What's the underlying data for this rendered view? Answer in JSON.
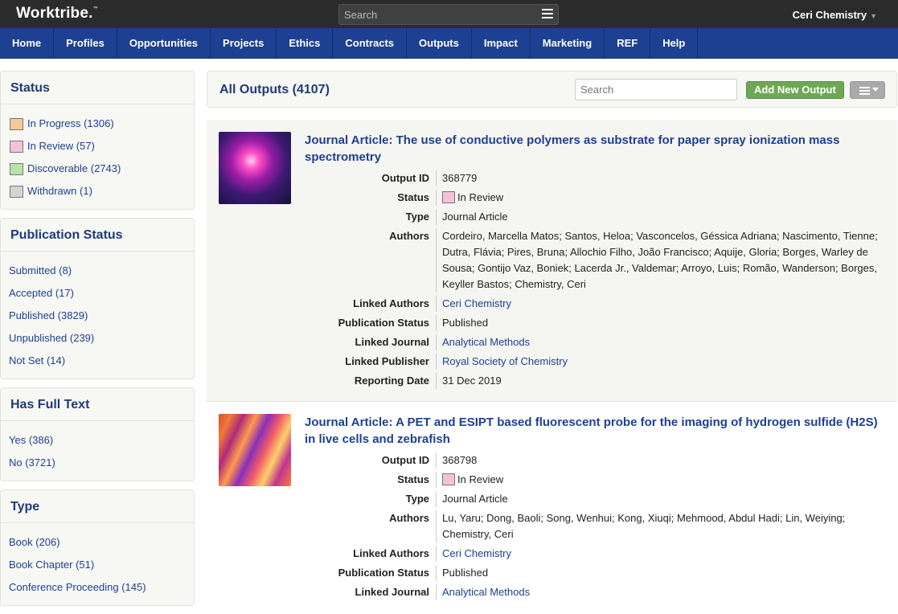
{
  "topbar": {
    "logo": "Worktribe.",
    "logo_tm": "™",
    "search_placeholder": "Search",
    "user": "Ceri Chemistry"
  },
  "nav": [
    "Home",
    "Profiles",
    "Opportunities",
    "Projects",
    "Ethics",
    "Contracts",
    "Outputs",
    "Impact",
    "Marketing",
    "REF",
    "Help"
  ],
  "sidebar": {
    "status": {
      "title": "Status",
      "items": [
        {
          "label": "In Progress (1306)",
          "color": "#f5c99a"
        },
        {
          "label": "In Review (57)",
          "color": "#f3c1d8"
        },
        {
          "label": "Discoverable (2743)",
          "color": "#b9e3a6"
        },
        {
          "label": "Withdrawn (1)",
          "color": "#d4d4d4"
        }
      ]
    },
    "publication_status": {
      "title": "Publication Status",
      "items": [
        "Submitted (8)",
        "Accepted (17)",
        "Published (3829)",
        "Unpublished (239)",
        "Not Set (14)"
      ]
    },
    "full_text": {
      "title": "Has Full Text",
      "items": [
        "Yes (386)",
        "No (3721)"
      ]
    },
    "type": {
      "title": "Type",
      "items": [
        "Book (206)",
        "Book Chapter (51)",
        "Conference Proceeding (145)"
      ]
    }
  },
  "main": {
    "title": "All Outputs (4107)",
    "search_placeholder": "Search",
    "add_label": "Add New Output"
  },
  "outputs": [
    {
      "title": "Journal Article: The use of conductive polymers as substrate for paper spray ionization mass spectrometry",
      "labels": {
        "output_id": "Output ID",
        "status": "Status",
        "type": "Type",
        "authors": "Authors",
        "linked_authors": "Linked Authors",
        "publication_status": "Publication Status",
        "linked_journal": "Linked Journal",
        "linked_publisher": "Linked Publisher",
        "reporting_date": "Reporting Date"
      },
      "output_id": "368779",
      "status": "In Review",
      "type": "Journal Article",
      "authors": "Cordeiro, Marcella Matos; Santos, Heloa; Vasconcelos, Géssica Adriana; Nascimento, Tienne; Dutra, Flávia; Pires, Bruna; Allochio Filho, João Francisco; Aquije, Gloria; Borges, Warley de Sousa; Gontijo Vaz, Boniek; Lacerda Jr., Valdemar; Arroyo, Luis; Romão, Wanderson; Borges, Keyller Bastos; Chemistry, Ceri",
      "linked_authors": "Ceri Chemistry",
      "publication_status": "Published",
      "linked_journal": "Analytical Methods",
      "linked_publisher": "Royal Society of Chemistry",
      "reporting_date": "31 Dec 2019"
    },
    {
      "title": "Journal Article: A PET and ESIPT based fluorescent probe for the imaging of hydrogen sulfide (H2S) in live cells and zebrafish",
      "labels": {
        "output_id": "Output ID",
        "status": "Status",
        "type": "Type",
        "authors": "Authors",
        "linked_authors": "Linked Authors",
        "publication_status": "Publication Status",
        "linked_journal": "Linked Journal"
      },
      "output_id": "368798",
      "status": "In Review",
      "type": "Journal Article",
      "authors": "Lu, Yaru; Dong, Baoli; Song, Wenhui; Kong, Xiuqi; Mehmood, Abdul Hadi; Lin, Weiying; Chemistry, Ceri",
      "linked_authors": "Ceri Chemistry",
      "publication_status": "Published",
      "linked_journal": "Analytical Methods"
    }
  ],
  "colors": {
    "nav": "#1d4092",
    "topbar": "#2b2b2b",
    "add_button": "#6da854",
    "in_review": "#f3c1d8"
  }
}
